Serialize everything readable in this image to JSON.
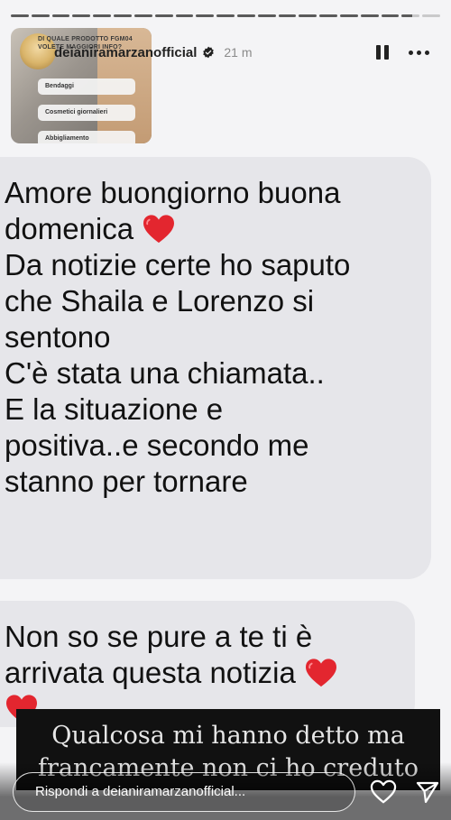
{
  "story": {
    "progress_segments": [
      1,
      1,
      1,
      1,
      1,
      1,
      1,
      1,
      1,
      1,
      1,
      1,
      1,
      1,
      1,
      1,
      1,
      1,
      1,
      0.6,
      0
    ],
    "username": "deianiramarzanofficial",
    "time_ago": "21 m",
    "verified_icon": "verified-badge-icon",
    "pause_icon": "pause-icon",
    "more_icon": "more-dots-icon"
  },
  "thumbnail": {
    "question": "DI QUALE PRODOTTO FGM04 VOLETE MAGGIORI INFO?",
    "options": [
      "Bendaggi",
      "Cosmetici giornalieri",
      "Abbigliamento"
    ]
  },
  "messages": {
    "bubble1": {
      "line1": "Amore buongiorno buona",
      "line2": "domenica",
      "line3": "Da notizie certe ho saputo",
      "line4": "che Shaila e Lorenzo si",
      "line5": "sentono",
      "line6": "C'è stata una chiamata..",
      "line7": "E la situazione e",
      "line8": "positiva..e secondo me",
      "line9": "stanno per tornare"
    },
    "bubble2": {
      "line1": "Non so se pure a te ti è",
      "line2": "arrivata questa notizia"
    },
    "heart_emoji": "red-heart-icon"
  },
  "caption": {
    "line1": "Qualcosa mi hanno detto ma",
    "line2": "francamente non ci ho creduto"
  },
  "reply": {
    "placeholder": "Rispondi a deianiramarzanofficial...",
    "like_icon": "heart-outline-icon",
    "send_icon": "send-icon"
  },
  "colors": {
    "heart": "#e3262f",
    "bubble": "#e6e6ea",
    "caption_bg": "#111111"
  }
}
